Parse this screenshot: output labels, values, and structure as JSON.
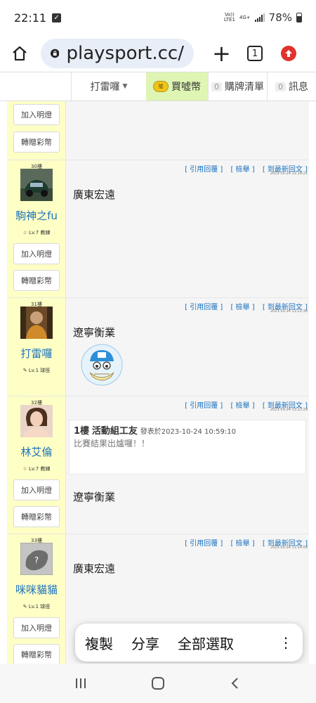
{
  "status": {
    "time": "22:11",
    "net1": "Vo))\nLTE1",
    "net2": "4G+",
    "battery": "78%"
  },
  "browser": {
    "url": "playsport.cc/",
    "tab_count": "1"
  },
  "nav": {
    "user": "打雷囉",
    "buy": "買噓幣",
    "coin_label": "噓",
    "cart_count": "0",
    "cart": "購牌清單",
    "msg_count": "0",
    "msg": "訊息"
  },
  "buttons": {
    "add_light": "加入明燈",
    "gift": "轉贈彩幣"
  },
  "actions": {
    "quote": "[ 引用回覆 ]",
    "report": "[ 檢舉 ]",
    "latest": "[ 到最新回文 ]"
  },
  "posts": [
    {
      "floor": "30樓",
      "name": "駒神之fu",
      "level": "☆ Lv.7 教練",
      "time": "2023-10-24 11:18:21",
      "text": "廣東宏遠"
    },
    {
      "floor": "31樓",
      "name": "打雷囉",
      "level": "✎ Lv.1 球徑",
      "time": "2023-10-24 11:21:36",
      "text": "遼寧衡業"
    },
    {
      "floor": "32樓",
      "name": "林艾倫",
      "level": "☆ Lv.7 教練",
      "time": "2023-10-24 11:22:29",
      "text": "遼寧衡業",
      "quote": {
        "floor": "1樓",
        "author": "活動組工友",
        "posted_label": "發表於",
        "posted": "2023-10-24 10:59:10",
        "text": "比賽結果出爐囉！！"
      }
    },
    {
      "floor": "33樓",
      "name": "咪咪貓貓",
      "level": "✎ Lv.1 球徑",
      "time": "2023-10-24 11:24:09",
      "text": "廣東宏遠"
    }
  ],
  "context_menu": {
    "copy": "複製",
    "share": "分享",
    "select_all": "全部選取"
  }
}
